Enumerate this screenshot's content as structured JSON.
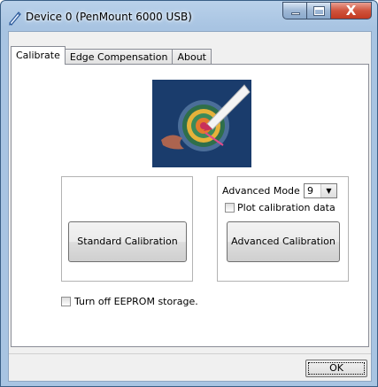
{
  "window": {
    "title": "Device 0 (PenMount 6000 USB)",
    "icon": "pen-icon",
    "caption_buttons": {
      "minimize": "minimize-icon",
      "maximize": "maximize-icon",
      "close_glyph": "X"
    }
  },
  "tabs": [
    {
      "label": "Calibrate",
      "active": true
    },
    {
      "label": "Edge Compensation",
      "active": false
    },
    {
      "label": "About",
      "active": false
    }
  ],
  "calibrate": {
    "logo": "calibration-target-icon",
    "standard_calibration_label": "Standard Calibration",
    "advanced": {
      "mode_label": "Advanced Mode",
      "mode_value": "9",
      "plot_label": "Plot calibration data",
      "plot_checked": false,
      "button_label": "Advanced Calibration"
    },
    "eeprom_label": "Turn off EEPROM storage.",
    "eeprom_checked": false
  },
  "footer": {
    "ok_label": "OK"
  },
  "colors": {
    "frame": "#a8c4e2",
    "logo_bg": "#1a3c6c",
    "close_btn": "#c8432a"
  }
}
